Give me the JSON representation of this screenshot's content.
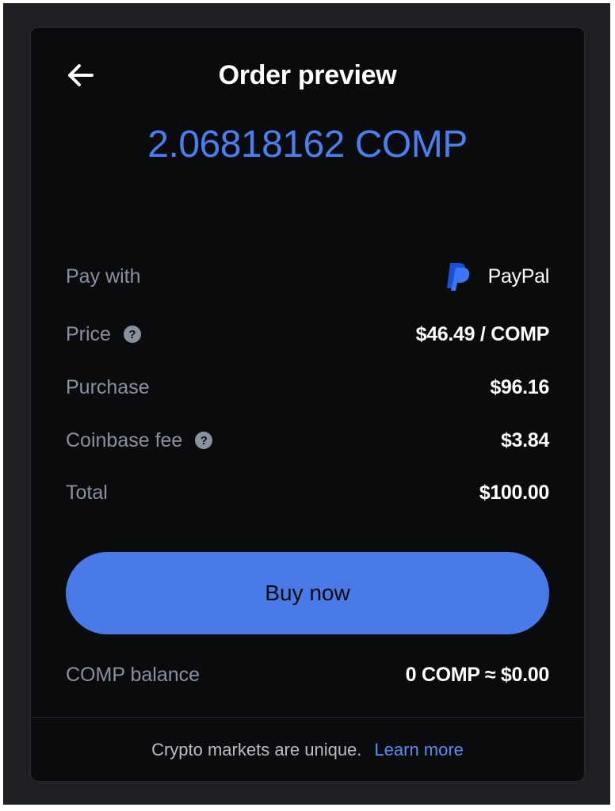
{
  "header": {
    "title": "Order preview",
    "back_icon": "arrow-left-icon"
  },
  "order": {
    "amount": "2.06818162 COMP",
    "accent_color": "#4a7ff0"
  },
  "details": {
    "pay_with": {
      "label": "Pay with",
      "value": "PayPal",
      "icon": "paypal-icon"
    },
    "price": {
      "label": "Price",
      "value": "$46.49 / COMP",
      "help": "?"
    },
    "purchase": {
      "label": "Purchase",
      "value": "$96.16"
    },
    "fee": {
      "label": "Coinbase fee",
      "value": "$3.84",
      "help": "?"
    },
    "total": {
      "label": "Total",
      "value": "$100.00"
    }
  },
  "buy_button": {
    "label": "Buy now",
    "color": "#4a7ae8"
  },
  "balance": {
    "label": "COMP balance",
    "value": "0 COMP ≈ $0.00"
  },
  "footer": {
    "text": "Crypto markets are unique.",
    "link": "Learn more"
  }
}
